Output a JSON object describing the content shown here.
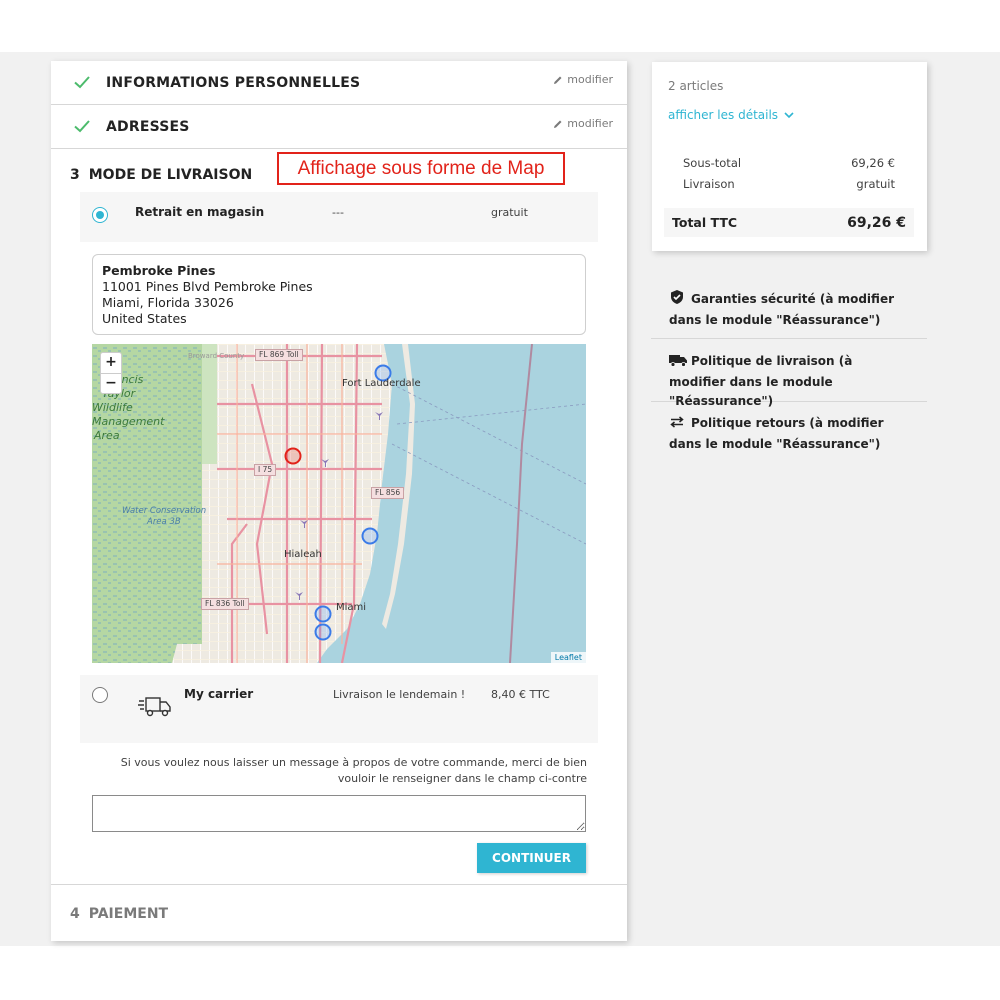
{
  "steps": {
    "personal": {
      "title": "INFORMATIONS PERSONNELLES",
      "edit_label": "modifier"
    },
    "addresses": {
      "title": "ADRESSES",
      "edit_label": "modifier"
    },
    "shipping": {
      "number": "3",
      "title": "MODE DE LIVRAISON"
    },
    "payment": {
      "number": "4",
      "title": "PAIEMENT"
    }
  },
  "annotation": "Affichage sous forme de Map",
  "carriers": [
    {
      "name": "Retrait en magasin",
      "delay": "---",
      "price": "gratuit",
      "selected": true
    },
    {
      "name": "My carrier",
      "delay": "Livraison le lendemain !",
      "price": "8,40 € TTC",
      "selected": false,
      "icon": "truck-icon"
    }
  ],
  "store": {
    "name": "Pembroke Pines",
    "street": "11001 Pines Blvd Pembroke Pines",
    "city": "Miami, Florida 33026",
    "country": "United States"
  },
  "map": {
    "zoom_in": "+",
    "zoom_out": "−",
    "attribution": "Leaflet",
    "places": {
      "fort_lauderdale": "Fort Lauderdale",
      "hialeah": "Hialeah",
      "miami": "Miami",
      "park1": "Francis",
      "park2": "Taylor",
      "park3": "Wildlife",
      "park4": "Management",
      "park5": "Area",
      "park6": "Water Conservation",
      "park7": "Area 3B",
      "county": "Broward County"
    },
    "roads": {
      "fl869": "FL 869 Toll",
      "i75": "I 75",
      "fl856": "FL 856",
      "fl836": "FL 836 Toll"
    }
  },
  "message": {
    "prompt": "Si vous voulez nous laisser un message à propos de votre commande, merci de bien vouloir le renseigner dans le champ ci-contre",
    "value": ""
  },
  "continue_label": "CONTINUER",
  "summary": {
    "count": "2 articles",
    "details_label": "afficher les détails",
    "subtotal_label": "Sous-total",
    "subtotal_value": "69,26 €",
    "shipping_label": "Livraison",
    "shipping_value": "gratuit",
    "total_label": "Total TTC",
    "total_value": "69,26 €"
  },
  "reassurance": [
    {
      "icon": "shield-icon",
      "text": "Garanties sécurité (à modifier dans le module \"Réassurance\")"
    },
    {
      "icon": "truck-icon",
      "text": "Politique de livraison (à modifier dans le module \"Réassurance\")"
    },
    {
      "icon": "exchange-arrows-icon",
      "text": "Politique retours (à modifier dans le module \"Réassurance\")"
    }
  ],
  "colors": {
    "accent": "#2fb5d2",
    "annotation": "#e2231a",
    "water": "#aad3df",
    "park": "#b5d7a3"
  }
}
